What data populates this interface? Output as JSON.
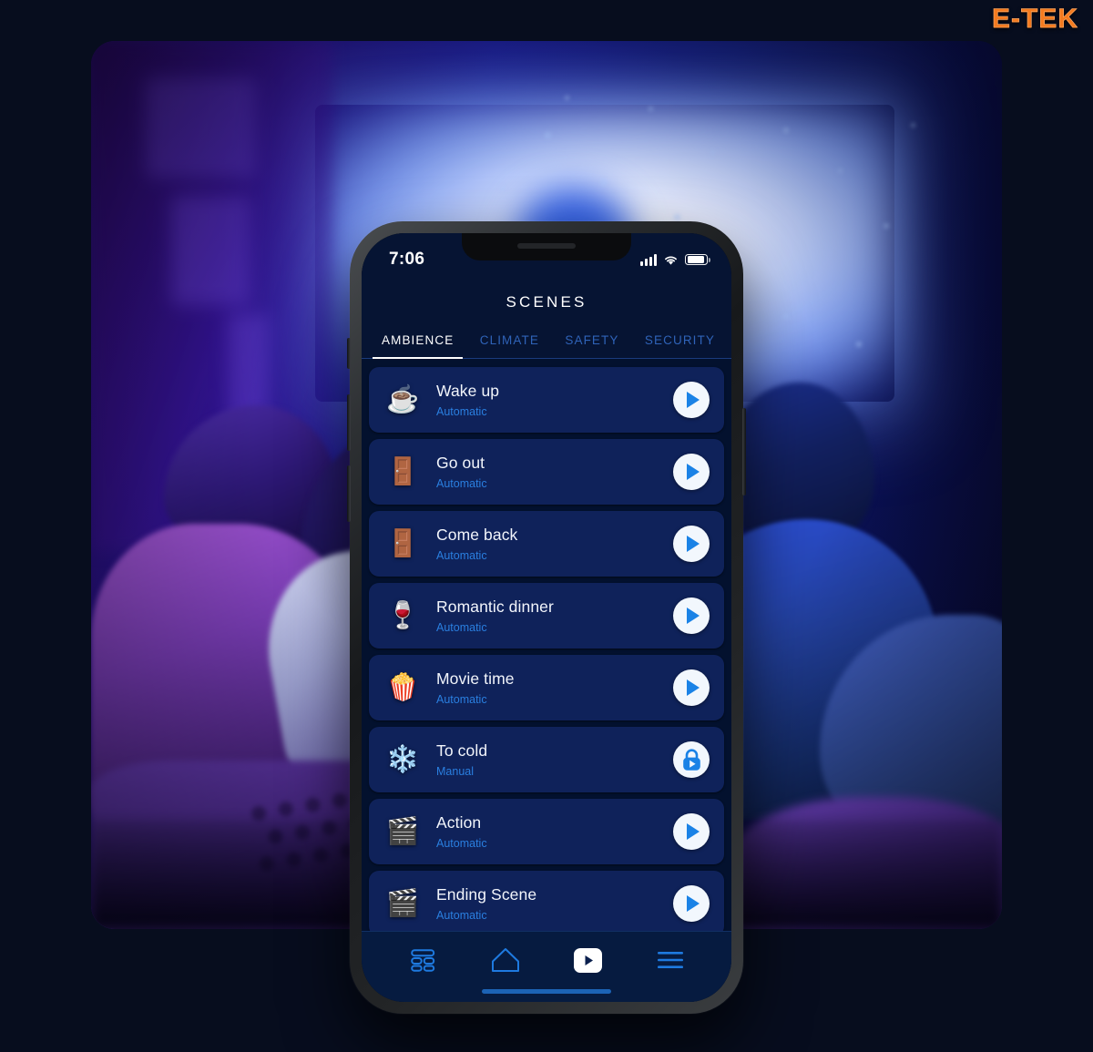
{
  "brand": {
    "label": "E-TEK"
  },
  "phone": {
    "statusbar": {
      "time": "7:06",
      "signal_icon": "cellular-bars-icon",
      "wifi_icon": "wifi-icon",
      "battery_icon": "battery-icon"
    },
    "app_title": "SCENES",
    "tabs": [
      {
        "label": "AMBIENCE",
        "active": true
      },
      {
        "label": "CLIMATE",
        "active": false
      },
      {
        "label": "SAFETY",
        "active": false
      },
      {
        "label": "SECURITY",
        "active": false
      }
    ],
    "scenes": [
      {
        "emoji": "☕",
        "icon_name": "coffee-cup-icon",
        "title": "Wake up",
        "mode": "Automatic",
        "action": "play"
      },
      {
        "emoji": "🚪",
        "icon_name": "door-exit-icon",
        "title": "Go out",
        "mode": "Automatic",
        "action": "play"
      },
      {
        "emoji": "🚪",
        "icon_name": "door-enter-icon",
        "title": "Come back",
        "mode": "Automatic",
        "action": "play"
      },
      {
        "emoji": "🍷",
        "icon_name": "wine-glasses-icon",
        "title": "Romantic dinner",
        "mode": "Automatic",
        "action": "play"
      },
      {
        "emoji": "🍿",
        "icon_name": "popcorn-3d-glasses-icon",
        "title": "Movie time",
        "mode": "Automatic",
        "action": "play"
      },
      {
        "emoji": "❄️",
        "icon_name": "snowflake-icon",
        "title": "To cold",
        "mode": "Manual",
        "action": "lock"
      },
      {
        "emoji": "🎬",
        "icon_name": "clapperboard-icon",
        "title": "Action",
        "mode": "Automatic",
        "action": "play"
      },
      {
        "emoji": "🎬",
        "icon_name": "clapperboard-icon",
        "title": "Ending Scene",
        "mode": "Automatic",
        "action": "play"
      }
    ],
    "bottom_nav": [
      {
        "icon_name": "dashboard-grid-icon",
        "active": false
      },
      {
        "icon_name": "home-icon",
        "active": false
      },
      {
        "icon_name": "play-scenes-icon",
        "active": true
      },
      {
        "icon_name": "menu-hamburger-icon",
        "active": false
      }
    ],
    "home_indicator": "home-indicator"
  },
  "colors": {
    "brand_orange": "#f47b20",
    "card_bg": "#0f225a",
    "screen_bg": "#03112e",
    "accent_blue": "#1a82e6",
    "sub_text": "#2a7fe0",
    "page_bg": "#070d1e"
  }
}
